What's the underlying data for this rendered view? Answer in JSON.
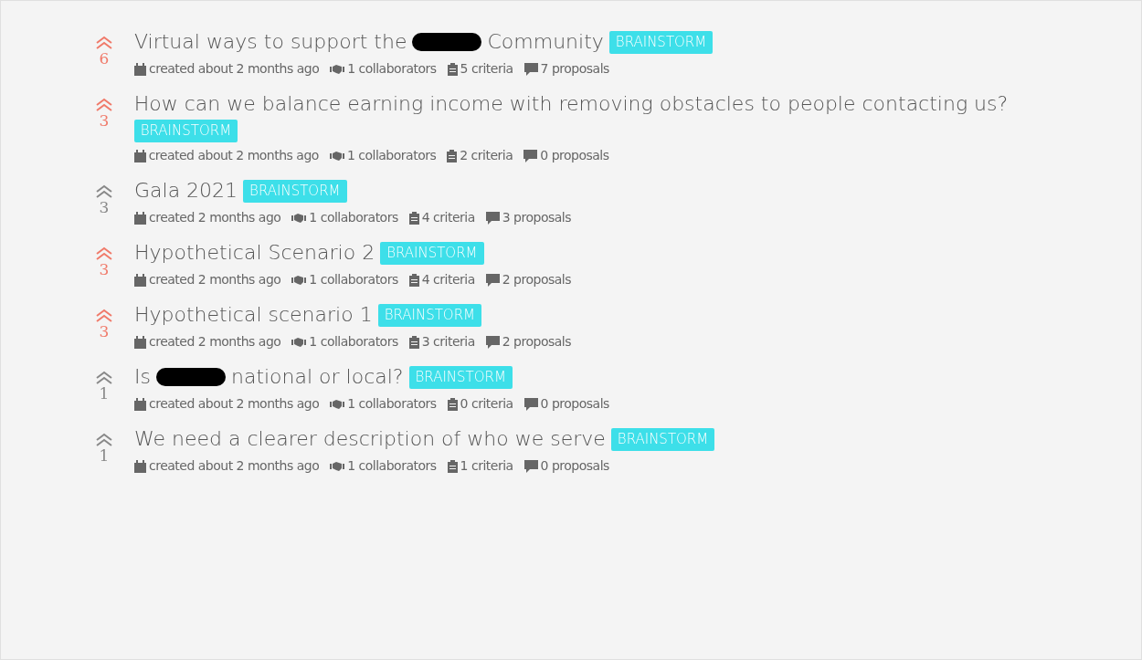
{
  "items": [
    {
      "votes": "6",
      "upvoted": true,
      "title": [
        {
          "kind": "text",
          "text": "Virtual ways to support the"
        },
        {
          "kind": "redaction"
        },
        {
          "kind": "text",
          "text": "Community"
        }
      ],
      "tag": "BRAINSTORM",
      "created": "created about 2 months ago",
      "collaborators": "1 collaborators",
      "criteria": "5 criteria",
      "proposals": "7 proposals"
    },
    {
      "votes": "3",
      "upvoted": true,
      "title": [
        {
          "kind": "text",
          "text": "How can we balance earning income with removing obstacles to people contacting us?"
        }
      ],
      "tag": "BRAINSTORM",
      "created": "created about 2 months ago",
      "collaborators": "1 collaborators",
      "criteria": "2 criteria",
      "proposals": "0 proposals"
    },
    {
      "votes": "3",
      "upvoted": false,
      "title": [
        {
          "kind": "text",
          "text": "Gala 2021"
        }
      ],
      "tag": "BRAINSTORM",
      "created": "created 2 months ago",
      "collaborators": "1 collaborators",
      "criteria": "4 criteria",
      "proposals": "3 proposals"
    },
    {
      "votes": "3",
      "upvoted": true,
      "title": [
        {
          "kind": "text",
          "text": "Hypothetical Scenario 2"
        }
      ],
      "tag": "BRAINSTORM",
      "created": "created 2 months ago",
      "collaborators": "1 collaborators",
      "criteria": "4 criteria",
      "proposals": "2 proposals"
    },
    {
      "votes": "3",
      "upvoted": true,
      "title": [
        {
          "kind": "text",
          "text": "Hypothetical scenario 1"
        }
      ],
      "tag": "BRAINSTORM",
      "created": "created 2 months ago",
      "collaborators": "1 collaborators",
      "criteria": "3 criteria",
      "proposals": "2 proposals"
    },
    {
      "votes": "1",
      "upvoted": false,
      "title": [
        {
          "kind": "text",
          "text": "Is"
        },
        {
          "kind": "redaction"
        },
        {
          "kind": "text",
          "text": "national or local?"
        }
      ],
      "tag": "BRAINSTORM",
      "created": "created about 2 months ago",
      "collaborators": "1 collaborators",
      "criteria": "0 criteria",
      "proposals": "0 proposals"
    },
    {
      "votes": "1",
      "upvoted": false,
      "title": [
        {
          "kind": "text",
          "text": "We need a clearer description of who we serve"
        }
      ],
      "tag": "BRAINSTORM",
      "created": "created about 2 months ago",
      "collaborators": "1 collaborators",
      "criteria": "1 criteria",
      "proposals": "0 proposals"
    }
  ]
}
